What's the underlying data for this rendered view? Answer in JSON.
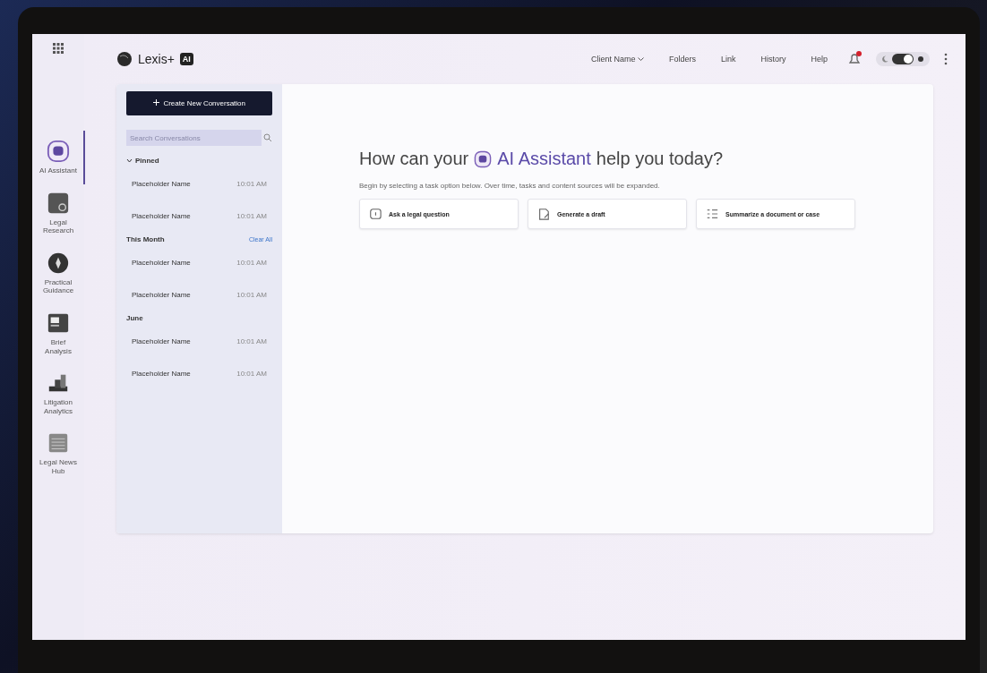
{
  "brand": {
    "name": "Lexis+",
    "badge": "AI"
  },
  "top_nav": [
    {
      "label": "Client Name",
      "dropdown": true
    },
    {
      "label": "Folders",
      "dropdown": false
    },
    {
      "label": "Link",
      "dropdown": false
    },
    {
      "label": "History",
      "dropdown": false
    },
    {
      "label": "Help",
      "dropdown": false
    }
  ],
  "theme_toggle": {
    "on": true
  },
  "rail": [
    {
      "label": "AI Assistant",
      "kind": "chat",
      "selected": true
    },
    {
      "label": "Legal Research",
      "kind": "research",
      "selected": false
    },
    {
      "label": "Practical Guidance",
      "kind": "compass",
      "selected": false
    },
    {
      "label": "Brief Analysis",
      "kind": "brief",
      "selected": false
    },
    {
      "label": "Litigation Analytics",
      "kind": "chart",
      "selected": false
    },
    {
      "label": "Legal News Hub",
      "kind": "news",
      "selected": false
    }
  ],
  "sidebar": {
    "new_button": "Create New Conversation",
    "search": {
      "placeholder": "Search Conversations"
    },
    "groups": [
      {
        "title": "Pinned",
        "expanded": true,
        "items": [
          {
            "name": "Placeholder Name",
            "time": "10:01 AM"
          },
          {
            "name": "Placeholder Name",
            "time": "10:01 AM"
          }
        ]
      },
      {
        "title": "This Month",
        "action": "Clear All",
        "items": [
          {
            "name": "Placeholder Name",
            "time": "10:01 AM"
          },
          {
            "name": "Placeholder Name",
            "time": "10:01 AM"
          }
        ]
      },
      {
        "title": "June",
        "items": [
          {
            "name": "Placeholder Name",
            "time": "10:01 AM"
          },
          {
            "name": "Placeholder Name",
            "time": "10:01 AM"
          }
        ]
      }
    ]
  },
  "main": {
    "heading_before": "How can your",
    "heading_highlight": "AI Assistant",
    "heading_after": "help you today?",
    "hint": "Begin by selecting a task option below. Over time, tasks and content sources will be expanded.",
    "tasks": [
      {
        "label": "Ask a legal question",
        "kind": "question"
      },
      {
        "label": "Generate a draft",
        "kind": "draft"
      },
      {
        "label": "Summarize a document or case",
        "kind": "summary"
      }
    ]
  }
}
